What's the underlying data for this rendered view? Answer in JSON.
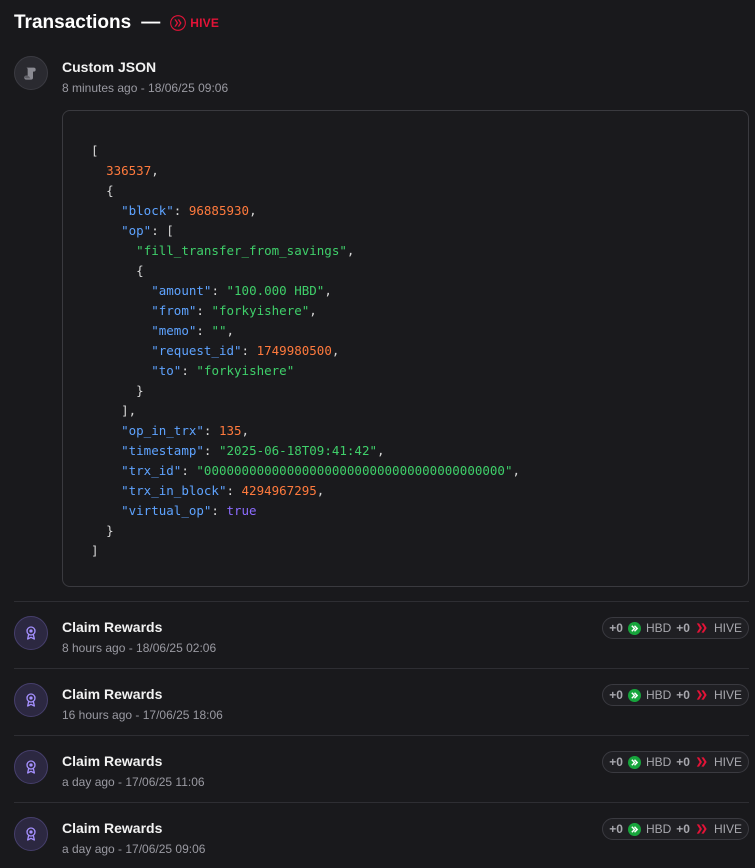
{
  "header": {
    "title": "Transactions",
    "separator": "—",
    "chain": "HIVE"
  },
  "custom_json": {
    "title": "Custom JSON",
    "time": "8 minutes ago - 18/06/25 09:06",
    "json": {
      "index": "336537",
      "block": "96885930",
      "op_type": "fill_transfer_from_savings",
      "amount": "\"100.000 HBD\"",
      "from": "\"forkyishere\"",
      "memo": "\"\"",
      "request_id": "1749980500",
      "to": "\"forkyishere\"",
      "op_in_trx": "135",
      "timestamp": "\"2025-06-18T09:41:42\"",
      "trx_id": "\"0000000000000000000000000000000000000000\"",
      "trx_in_block": "4294967295",
      "virtual_op": "true"
    }
  },
  "claims": [
    {
      "title": "Claim Rewards",
      "time": "8 hours ago - 18/06/25 02:06",
      "hbd_amount": "+0",
      "hbd_label": "HBD",
      "hive_amount": "+0",
      "hive_label": "HIVE"
    },
    {
      "title": "Claim Rewards",
      "time": "16 hours ago - 17/06/25 18:06",
      "hbd_amount": "+0",
      "hbd_label": "HBD",
      "hive_amount": "+0",
      "hive_label": "HIVE"
    },
    {
      "title": "Claim Rewards",
      "time": "a day ago - 17/06/25 11:06",
      "hbd_amount": "+0",
      "hbd_label": "HBD",
      "hive_amount": "+0",
      "hive_label": "HIVE"
    },
    {
      "title": "Claim Rewards",
      "time": "a day ago - 17/06/25 09:06",
      "hbd_amount": "+0",
      "hbd_label": "HBD",
      "hive_amount": "+0",
      "hive_label": "HIVE"
    }
  ],
  "icons": {
    "custom_json": "scroll-icon",
    "claim": "award-icon",
    "hbd": "hbd-icon",
    "hive": "hive-icon"
  },
  "colors": {
    "hive_red": "#e31337",
    "hbd_green": "#17a53c",
    "key_blue": "#5ea3ff",
    "number_orange": "#ff7a3d",
    "string_green": "#3fcf6a",
    "bool_purple": "#8c6cff"
  }
}
